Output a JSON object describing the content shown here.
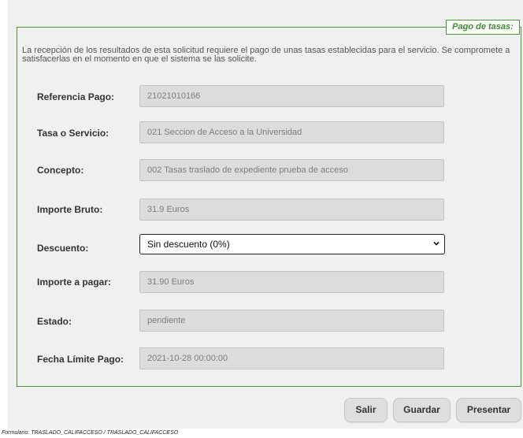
{
  "legend": "Pago de tasas:",
  "intro": "La recepción de los resultados de esta solicitud requiere el pago de unas tasas establecidas para el servicio. Se compromete a satisfacerlas en el momento en que el sistema se las solicite.",
  "fields": [
    {
      "label": "Referencia Pago:",
      "value": "21021010166"
    },
    {
      "label": "Tasa o Servicio:",
      "value": "021 Seccion de Acceso a la Universidad"
    },
    {
      "label": "Concepto:",
      "value": "002 Tasas traslado de expediente prueba de acceso"
    },
    {
      "label": "Importe Bruto:",
      "value": "31.9 Euros"
    },
    {
      "label": "Descuento:",
      "value": "Sin descuento (0%)"
    },
    {
      "label": "Importe a pagar:",
      "value": "31.90 Euros"
    },
    {
      "label": "Estado:",
      "value": "pendiente"
    },
    {
      "label": "Fecha Límite Pago:",
      "value": "2021-10-28 00:00:00"
    }
  ],
  "buttons": {
    "salir": "Salir",
    "guardar": "Guardar",
    "presentar": "Presentar"
  },
  "footer": "Formulario: TRASLADO_CALIFACCESO / TRASLADO_CALIFACCESO",
  "colors": {
    "accent": "#4a9a3a",
    "legend_text": "#3d8b2f",
    "field_bg": "#dcdcdc",
    "panel_bg": "#f0f0f0"
  }
}
